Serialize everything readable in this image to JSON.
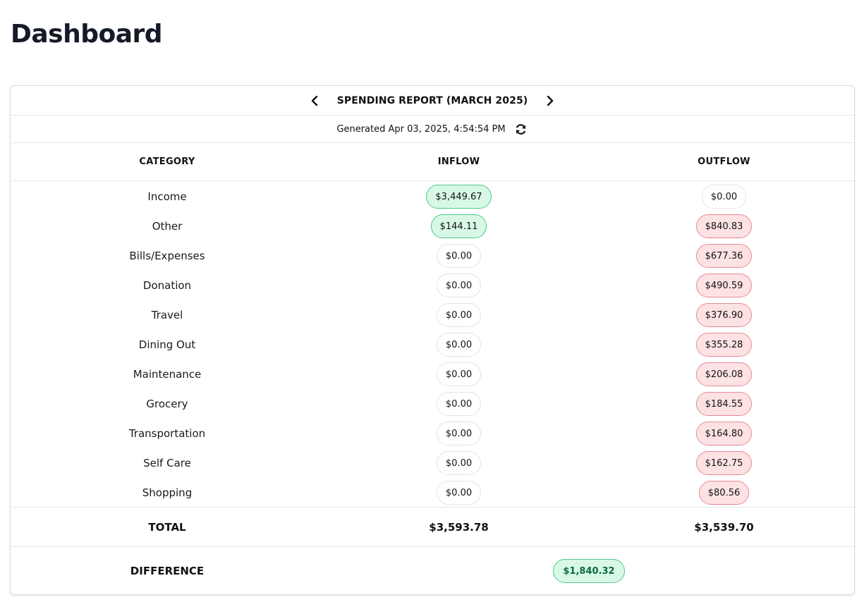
{
  "page": {
    "title": "Dashboard"
  },
  "report": {
    "title": "SPENDING REPORT (MARCH 2025)",
    "generated": "Generated Apr 03, 2025, 4:54:54 PM",
    "columns": {
      "category": "CATEGORY",
      "inflow": "INFLOW",
      "outflow": "OUTFLOW"
    },
    "rows": [
      {
        "category": "Income",
        "inflow": "$3,449.67",
        "outflow": "$0.00"
      },
      {
        "category": "Other",
        "inflow": "$144.11",
        "outflow": "$840.83"
      },
      {
        "category": "Bills/Expenses",
        "inflow": "$0.00",
        "outflow": "$677.36"
      },
      {
        "category": "Donation",
        "inflow": "$0.00",
        "outflow": "$490.59"
      },
      {
        "category": "Travel",
        "inflow": "$0.00",
        "outflow": "$376.90"
      },
      {
        "category": "Dining Out",
        "inflow": "$0.00",
        "outflow": "$355.28"
      },
      {
        "category": "Maintenance",
        "inflow": "$0.00",
        "outflow": "$206.08"
      },
      {
        "category": "Grocery",
        "inflow": "$0.00",
        "outflow": "$184.55"
      },
      {
        "category": "Transportation",
        "inflow": "$0.00",
        "outflow": "$164.80"
      },
      {
        "category": "Self Care",
        "inflow": "$0.00",
        "outflow": "$162.75"
      },
      {
        "category": "Shopping",
        "inflow": "$0.00",
        "outflow": "$80.56"
      }
    ],
    "total": {
      "label": "TOTAL",
      "inflow": "$3,593.78",
      "outflow": "$3,539.70"
    },
    "difference": {
      "label": "DIFFERENCE",
      "value": "$1,840.32"
    }
  },
  "icons": {
    "prev": "chevron-left-icon",
    "next": "chevron-right-icon",
    "refresh": "refresh-icon"
  },
  "colors": {
    "positive_bg": "#d8f8e6",
    "positive_border": "#4cc98a",
    "negative_bg": "#fde2e4",
    "negative_border": "#e58a93",
    "difference_text": "#0a6b3c"
  }
}
